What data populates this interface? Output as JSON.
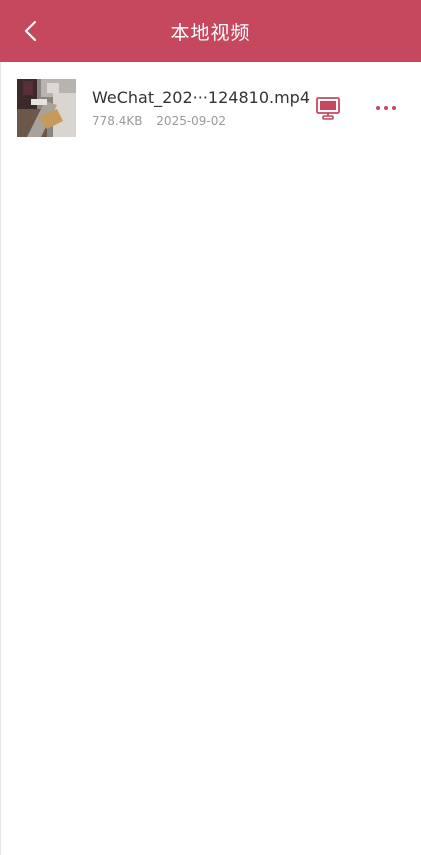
{
  "header": {
    "title": "本地视频",
    "background_color": "#c5485e",
    "back_icon": "chevron-left-icon"
  },
  "video_list": {
    "items": [
      {
        "file_name": "WeChat_202···124810.mp4",
        "size": "778.4KB",
        "date": "2025-09-02",
        "thumbnail_icon": "video-thumbnail",
        "cast_icon": "tv-cast-icon",
        "more_icon": "more-dots-icon"
      }
    ]
  },
  "colors": {
    "accent": "#c5485e",
    "text_primary": "#333333",
    "text_secondary": "#9a9a9a"
  }
}
